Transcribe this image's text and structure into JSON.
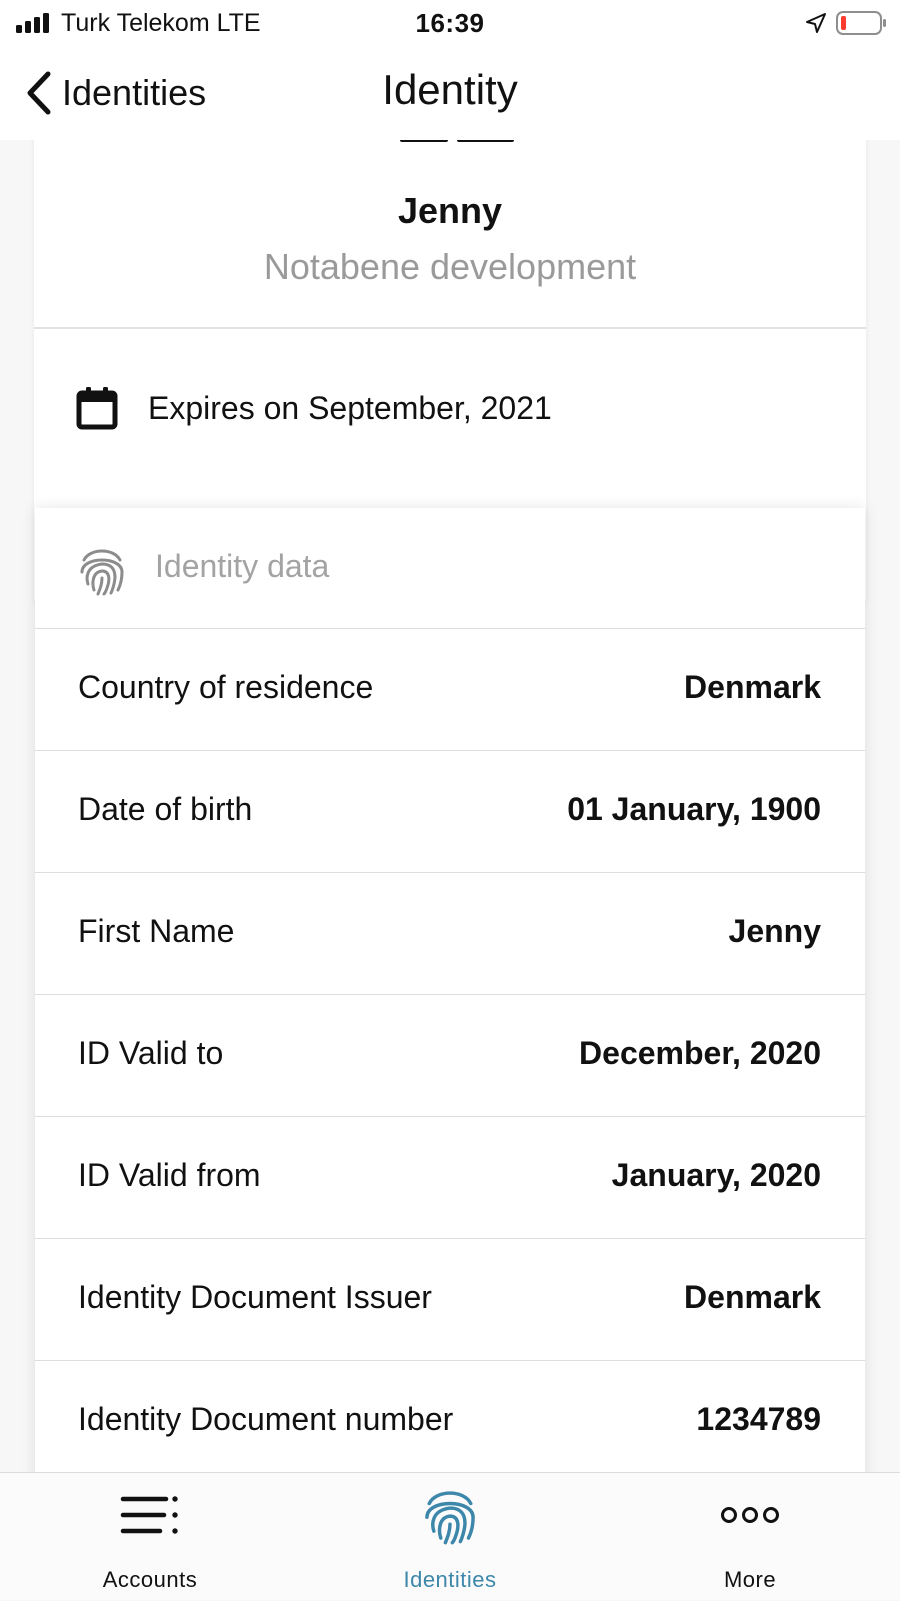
{
  "status_bar": {
    "carrier": "Turk Telekom  LTE",
    "time": "16:39",
    "battery_color": "#ff3b30"
  },
  "nav": {
    "back_label": "Identities",
    "title": "Identity"
  },
  "identity_card": {
    "name": "Jenny",
    "organization": "Notabene development",
    "expiry_icon": "calendar-icon",
    "expiry_text": "Expires on September, 2021"
  },
  "identity_data": {
    "header_icon": "fingerprint-icon",
    "header_label": "Identity data",
    "rows": [
      {
        "label": "Country of residence",
        "value": "Denmark"
      },
      {
        "label": "Date of birth",
        "value": "01 January, 1900"
      },
      {
        "label": "First Name",
        "value": "Jenny"
      },
      {
        "label": "ID Valid to",
        "value": "December, 2020"
      },
      {
        "label": "ID Valid from",
        "value": "January, 2020"
      },
      {
        "label": "Identity Document Issuer",
        "value": "Denmark"
      },
      {
        "label": "Identity Document number",
        "value": "1234789"
      }
    ]
  },
  "tab_bar": {
    "active_color": "#3d87ab",
    "inactive_color": "#111111",
    "tabs": [
      {
        "label": "Accounts",
        "icon": "menu-list-icon",
        "active": false
      },
      {
        "label": "Identities",
        "icon": "fingerprint-icon",
        "active": true
      },
      {
        "label": "More",
        "icon": "more-dots-icon",
        "active": false
      }
    ]
  }
}
